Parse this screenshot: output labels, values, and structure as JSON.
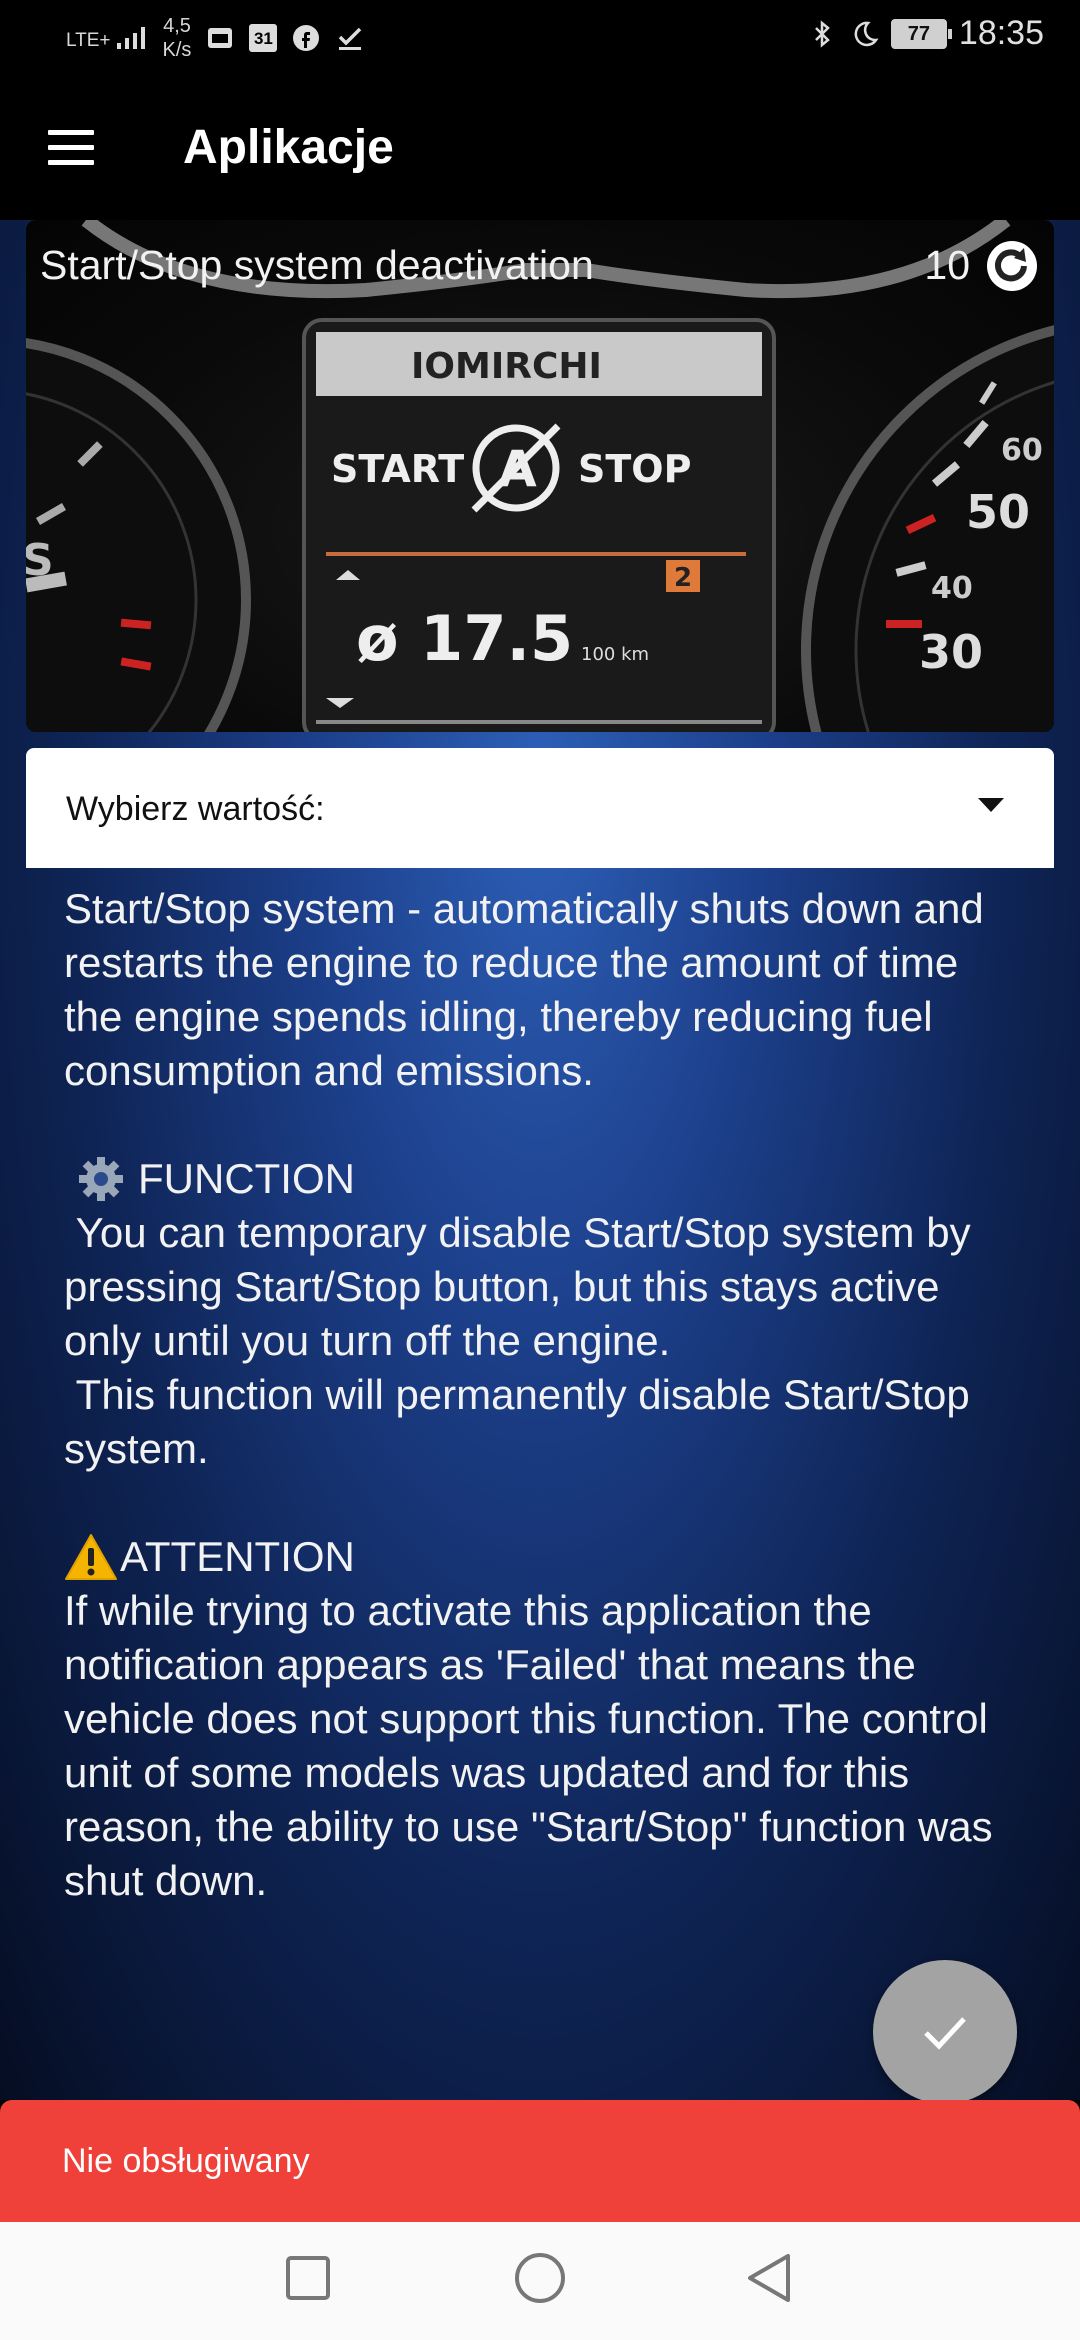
{
  "status_bar": {
    "network": "LTE+",
    "net_speed_value": "4,5",
    "net_speed_unit": "K/s",
    "calendar_day": "31",
    "battery": "77",
    "time": "18:35"
  },
  "app_bar": {
    "title": "Aplikacje"
  },
  "hero": {
    "title": "Start/Stop system deactivation",
    "count": "10",
    "dash_brand": "IOMIRCHI",
    "dash_start": "START",
    "dash_stop": "STOP",
    "dash_gear": "2",
    "dash_consumption": "ø 17.5",
    "dash_unit": "100 km",
    "gauge_60": "60",
    "gauge_50": "50",
    "gauge_40": "40",
    "gauge_30": "30"
  },
  "dropdown": {
    "label": "Wybierz wartość:"
  },
  "description": {
    "intro": "Start/Stop system - automatically shuts down and restarts the engine to reduce the amount of time the engine spends idling, thereby reducing fuel consumption and emissions.",
    "function_heading": "FUNCTION",
    "function_text_1": " You can temporary disable Start/Stop system by pressing Start/Stop button, but this stays active only until you turn off the engine.",
    "function_text_2": " This function will permanently disable Start/Stop system.",
    "attention_heading": "ATTENTION",
    "attention_text": "If while trying to activate this application the notification appears as 'Failed' that means the vehicle does not support this function. The control unit of some models was updated and for this reason, the ability to use \"Start/Stop\" function was shut down."
  },
  "snackbar": {
    "text": "Nie obsługiwany"
  },
  "colors": {
    "snackbar": "#f0403a",
    "fab": "#a3a3a3",
    "background": "#1c3f8a"
  },
  "icons": [
    "menu-icon",
    "refresh-icon",
    "gear-icon",
    "warning-icon",
    "check-icon",
    "square-icon",
    "circle-icon",
    "back-triangle-icon"
  ]
}
